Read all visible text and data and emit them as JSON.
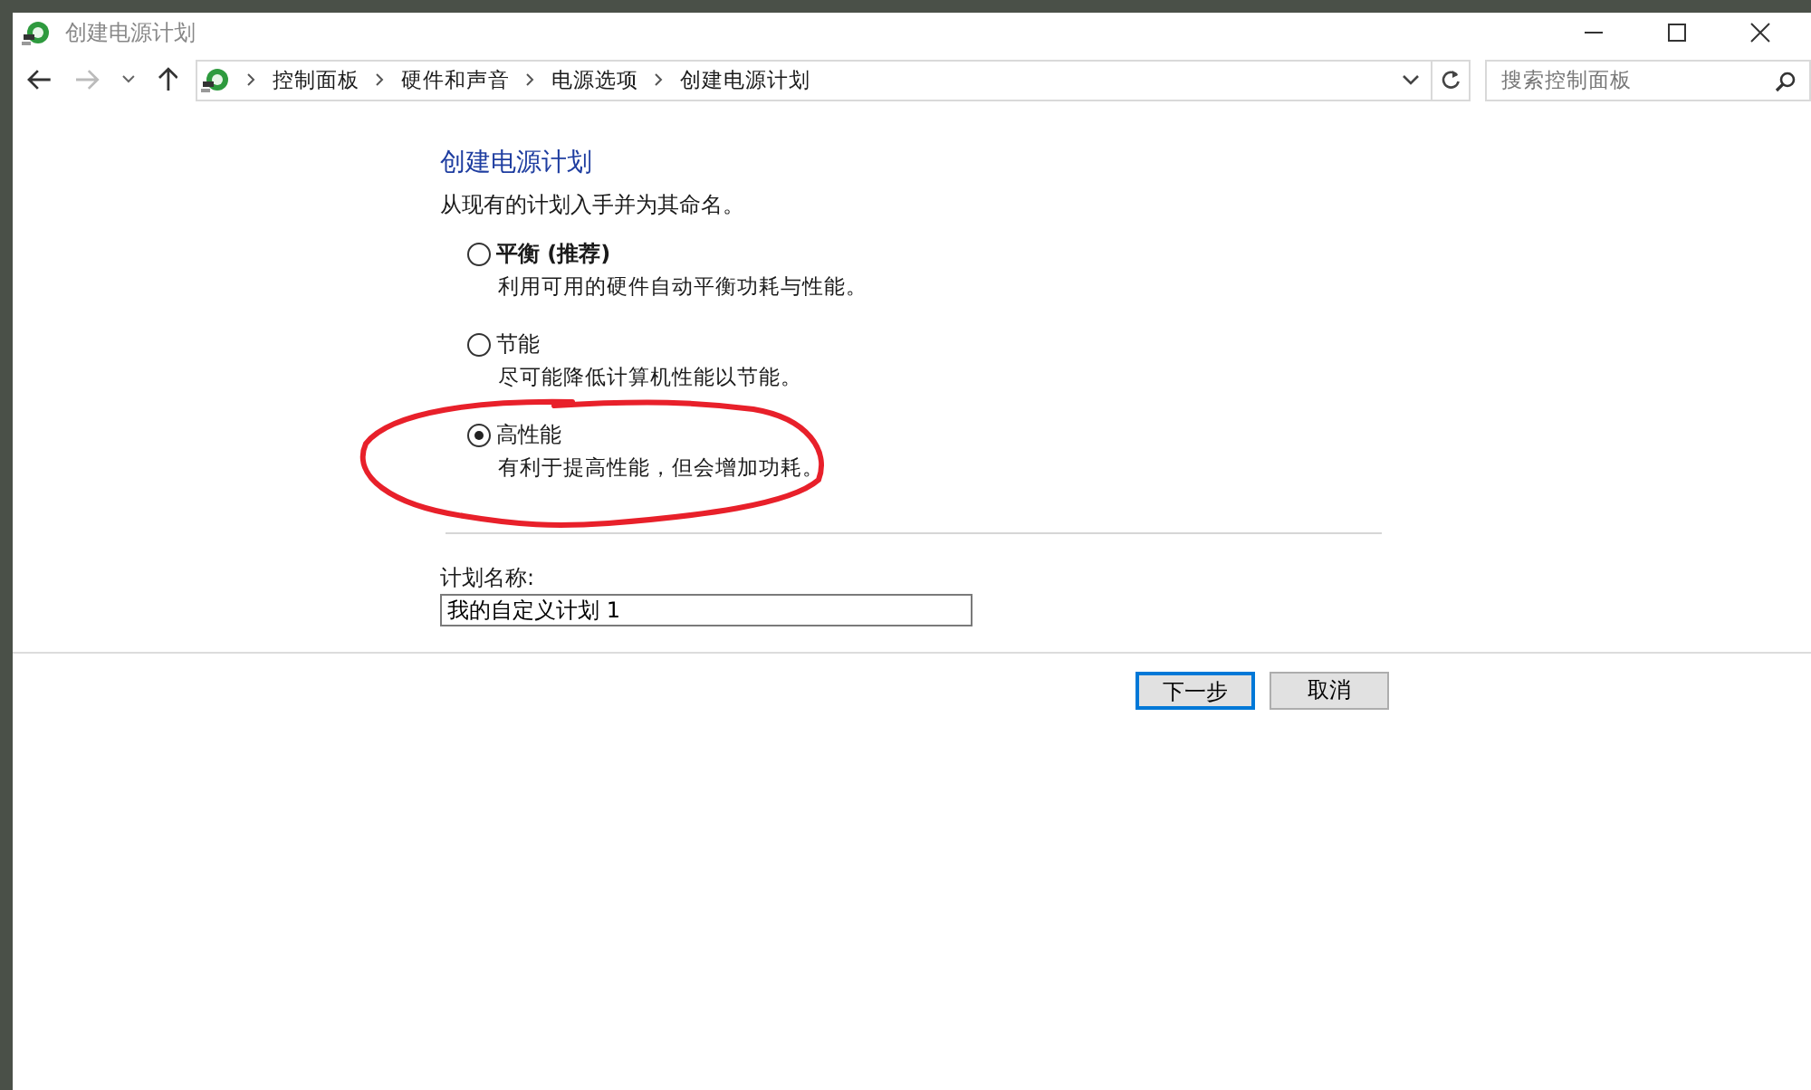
{
  "window": {
    "title": "创建电源计划"
  },
  "navigation": {
    "back_enabled": true,
    "forward_enabled": false
  },
  "breadcrumb": [
    "控制面板",
    "硬件和声音",
    "电源选项",
    "创建电源计划"
  ],
  "search": {
    "placeholder": "搜索控制面板"
  },
  "heading": "创建电源计划",
  "intro": "从现有的计划入手并为其命名。",
  "plans": [
    {
      "name": "平衡 (推荐)",
      "description": "利用可用的硬件自动平衡功耗与性能。",
      "recommended": true,
      "selected": false
    },
    {
      "name": "节能",
      "description": "尽可能降低计算机性能以节能。",
      "recommended": false,
      "selected": false
    },
    {
      "name": "高性能",
      "description": "有利于提高性能，但会增加功耗。",
      "recommended": false,
      "selected": true
    }
  ],
  "plan_name": {
    "label": "计划名称:",
    "value": "我的自定义计划 1"
  },
  "buttons": [
    {
      "label": "下一步",
      "default": true
    },
    {
      "label": "取消",
      "default": false
    }
  ]
}
